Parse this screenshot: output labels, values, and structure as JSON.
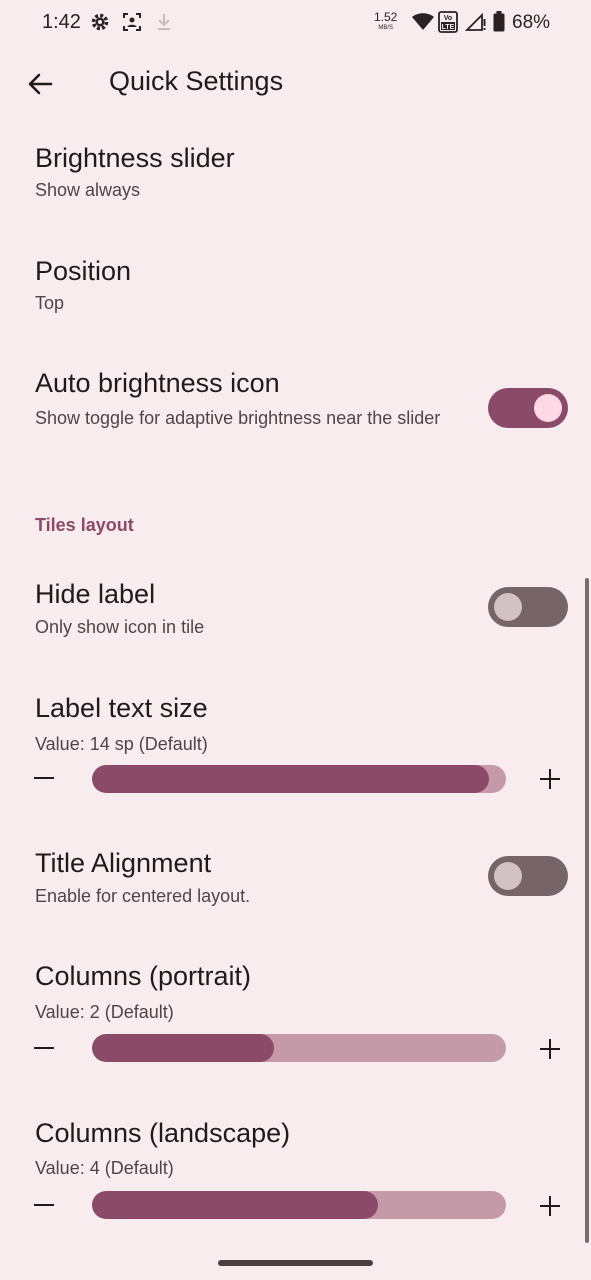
{
  "status_bar": {
    "time": "1:42",
    "speed_value": "1.52",
    "speed_unit": "MB/S",
    "battery": "68%",
    "icons": [
      "gear-icon",
      "screenshot-icon",
      "download-icon",
      "wifi-icon",
      "volte-icon",
      "signal-icon",
      "battery-icon"
    ]
  },
  "app_bar": {
    "title": "Quick Settings",
    "back_icon": "arrow-back-icon"
  },
  "items": {
    "brightness_slider": {
      "title": "Brightness slider",
      "summary": "Show always"
    },
    "position": {
      "title": "Position",
      "summary": "Top"
    },
    "auto_brightness": {
      "title": "Auto brightness icon",
      "summary": "Show toggle for adaptive brightness near the slider",
      "enabled": true
    },
    "section_tiles": "Tiles layout",
    "hide_label": {
      "title": "Hide label",
      "summary": "Only show icon in tile",
      "enabled": false
    },
    "label_text_size": {
      "title": "Label text size",
      "summary": "Value: 14 sp (Default)",
      "fraction": 0.96
    },
    "title_alignment": {
      "title": "Title Alignment",
      "summary": "Enable for centered layout.",
      "enabled": false
    },
    "columns_portrait": {
      "title": "Columns (portrait)",
      "summary": "Value: 2 (Default)",
      "fraction": 0.44
    },
    "columns_landscape": {
      "title": "Columns (landscape)",
      "summary": "Value: 4 (Default)",
      "fraction": 0.69
    }
  },
  "colors": {
    "accent": "#8b4a68",
    "background": "#f9ecee",
    "track": "#c59aa8"
  }
}
